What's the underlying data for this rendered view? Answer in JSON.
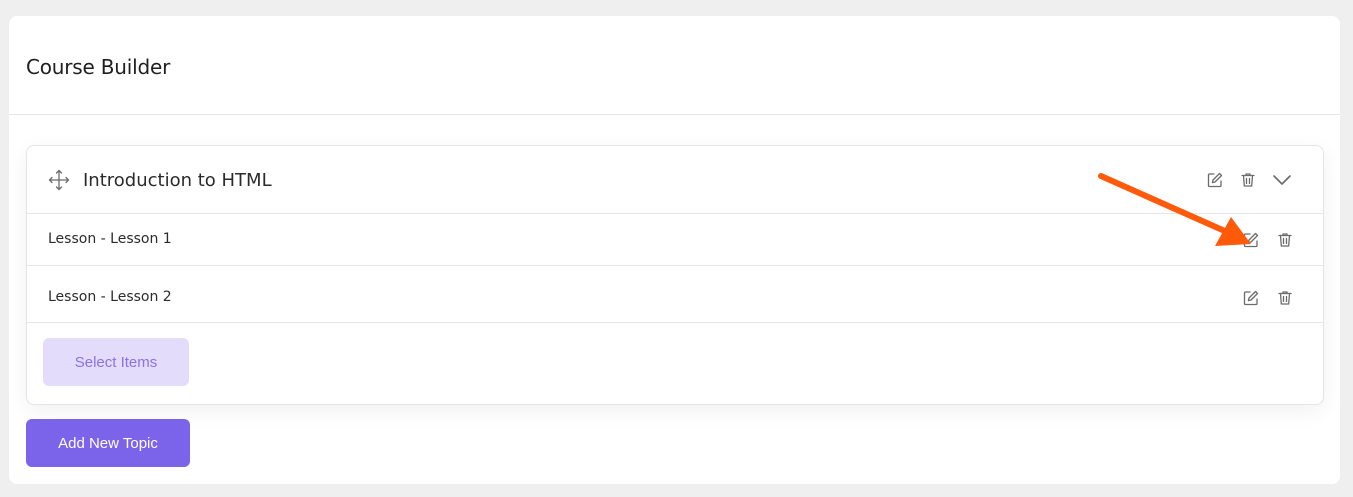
{
  "card": {
    "title": "Course Builder"
  },
  "topic": {
    "title": "Introduction to HTML",
    "actions": {
      "edit_icon": "edit-icon",
      "delete_icon": "trash-icon",
      "collapse_icon": "chevron-down-icon"
    },
    "lessons": [
      {
        "label": "Lesson - Lesson 1"
      },
      {
        "label": "Lesson - Lesson 2"
      }
    ],
    "select_items_label": "Select Items"
  },
  "add_topic_label": "Add New Topic",
  "colors": {
    "primary": "#7b63ea",
    "primary_light": "#e3dcfb",
    "primary_light_text": "#8a73e6",
    "annotation_arrow": "#ff5a0a",
    "icon": "#6b6b6b"
  }
}
